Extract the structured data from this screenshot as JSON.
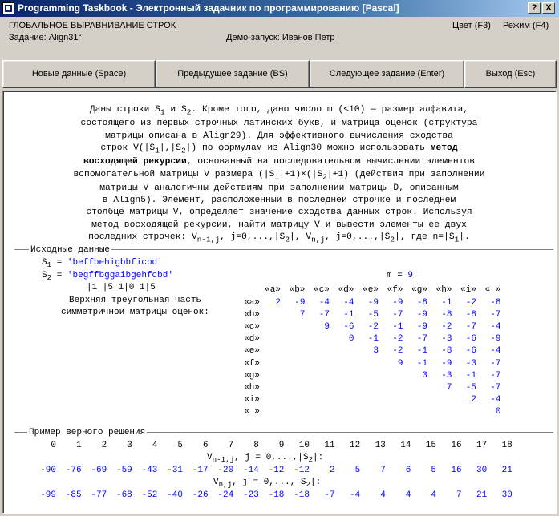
{
  "window": {
    "title": "Programming Taskbook - Электронный задачник по программированию [Pascal]",
    "help_btn": "?",
    "close_btn": "X"
  },
  "info": {
    "group_title": "ГЛОБАЛЬНОЕ ВЫРАВНИВАНИЕ СТРОК",
    "task": "Задание: Align31°",
    "demo": "Демо-запуск: Иванов Петр",
    "color": "Цвет (F3)",
    "mode": "Режим (F4)"
  },
  "buttons": {
    "new_data": "Новые данные (Space)",
    "prev_task": "Предыдущее задание (BS)",
    "next_task": "Следующее задание (Enter)",
    "exit": "Выход (Esc)"
  },
  "formulation": [
    "Даны строки S<sub>1</sub> и S<sub>2</sub>. Кроме того, дано число m (&lt;10) — размер алфавита,",
    "состоящего из первых строчных латинских букв, и матрица оценок (структура",
    "матрицы описана в Align29). Для эффективного вычисления сходства",
    "строк V(|S<sub>1</sub>|,|S<sub>2</sub>|) по формулам из Align30 можно использовать <b>метод</b>",
    "<b>восходящей рекурсии</b>, основанный на последовательном вычислении элементов",
    "вспомогательной матрицы V размера (|S<sub>1</sub>|+1)×(|S<sub>2</sub>|+1) (действия при заполнении",
    "матрицы V аналогичны действиям при заполнении матрицы D, описанным",
    "в Align5). Элемент, расположенный в последней строчке и последнем",
    "столбце матрицы V, определяет значение сходства данных строк. Используя",
    "метод восходящей рекурсии, найти матрицу V и вывести элементы ее двух",
    "последних строчек: V<sub>n-1,j</sub>, j=0,...,|S<sub>2</sub>|, V<sub>n,j</sub>, j=0,...,|S<sub>2</sub>|, где n=|S<sub>1</sub>|."
  ],
  "input": {
    "label": "Исходные данные",
    "s1_name": "S1",
    "s1_value": "'beffbehigbbficbd'",
    "s2_name": "S2",
    "s2_value": "'begffbggaibgehfcbd'",
    "m_label": "m =",
    "m_value": "9",
    "ruler": "|1   |5  1|0  1|5",
    "matrix_caption": [
      "Верхняя треугольная часть",
      "симметричной матрицы оценок:"
    ],
    "alphabet": [
      "«a»",
      "«b»",
      "«c»",
      "«d»",
      "«e»",
      "«f»",
      "«g»",
      "«h»",
      "«i»",
      "« »"
    ],
    "matrix": [
      [
        "2",
        "-9",
        "-4",
        "-4",
        "-9",
        "-9",
        "-8",
        "-1",
        "-2",
        "-8"
      ],
      [
        "7",
        "-7",
        "-1",
        "-5",
        "-7",
        "-9",
        "-8",
        "-8",
        "-7"
      ],
      [
        "9",
        "-6",
        "-2",
        "-1",
        "-9",
        "-2",
        "-7",
        "-4"
      ],
      [
        "0",
        "-1",
        "-2",
        "-7",
        "-3",
        "-6",
        "-9"
      ],
      [
        "3",
        "-2",
        "-1",
        "-8",
        "-6",
        "-4"
      ],
      [
        "9",
        "-1",
        "-9",
        "-3",
        "-7"
      ],
      [
        "3",
        "-3",
        "-1",
        "-7"
      ],
      [
        "7",
        "-5",
        "-7"
      ],
      [
        "2",
        "-4"
      ],
      [
        "0"
      ]
    ]
  },
  "solution": {
    "label": "Пример верного решения",
    "indices": [
      "0",
      "1",
      "2",
      "3",
      "4",
      "5",
      "6",
      "7",
      "8",
      "9",
      "10",
      "11",
      "12",
      "13",
      "14",
      "15",
      "16",
      "17",
      "18"
    ],
    "row1_label": "V<sub>n-1,j</sub>, j = 0,...,|S<sub>2</sub>|:",
    "row1": [
      "-90",
      "-76",
      "-69",
      "-59",
      "-43",
      "-31",
      "-17",
      "-20",
      "-14",
      "-12",
      "-12",
      "2",
      "5",
      "7",
      "6",
      "5",
      "16",
      "30",
      "21"
    ],
    "row2_label": "V<sub>n,j</sub>, j = 0,...,|S<sub>2</sub>|:",
    "row2": [
      "-99",
      "-85",
      "-77",
      "-68",
      "-52",
      "-40",
      "-26",
      "-24",
      "-23",
      "-18",
      "-18",
      "-7",
      "-4",
      "4",
      "4",
      "4",
      "7",
      "21",
      "30"
    ]
  },
  "colors": {
    "title_start": "#0a246a",
    "title_end": "#a6caf0",
    "value_blue": "#0000ff",
    "face": "#d4d0c8"
  }
}
